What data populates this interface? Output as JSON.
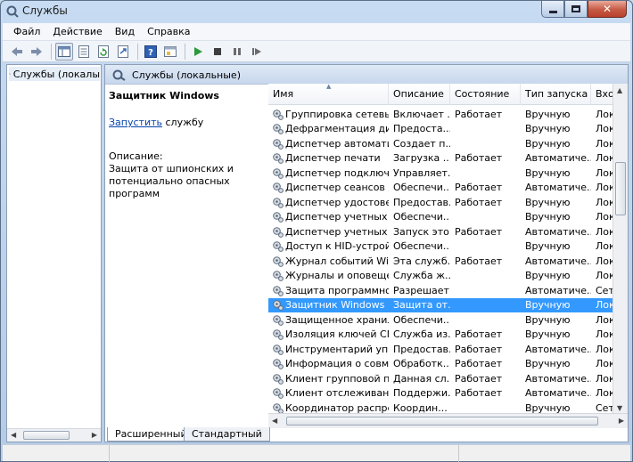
{
  "window": {
    "title": "Службы"
  },
  "menu": [
    "Файл",
    "Действие",
    "Вид",
    "Справка"
  ],
  "toolbar": [
    "back-icon",
    "forward-icon",
    "console-tree-icon",
    "properties-icon",
    "refresh-icon",
    "export-icon",
    "help-icon",
    "view-icon",
    "start-icon",
    "stop-icon",
    "pause-icon",
    "restart-icon"
  ],
  "tree": {
    "item": "Службы (локалы"
  },
  "panel": {
    "title": "Службы (локальные)"
  },
  "detail": {
    "name": "Защитник Windows",
    "action_link": "Запустить",
    "action_suffix": " службу",
    "desc_label": "Описание:",
    "desc_line1": "Защита от шпионских  и",
    "desc_line2": "потенциально опасных программ"
  },
  "table": {
    "headers": [
      "Имя",
      "Описание",
      "Состояние",
      "Тип запуска",
      "Вход"
    ],
    "selected_index": 13,
    "rows": [
      [
        "Группировка сетевых ...",
        "Включает ...",
        "Работает",
        "Вручную",
        "Лока"
      ],
      [
        "Дефрагментация диска",
        "Предоста...",
        "",
        "Вручную",
        "Лока"
      ],
      [
        "Диспетчер автоматич...",
        "Создает п...",
        "",
        "Вручную",
        "Лока"
      ],
      [
        "Диспетчер печати",
        "Загрузка ...",
        "Работает",
        "Автоматиче...",
        "Лока"
      ],
      [
        "Диспетчер подключе...",
        "Управляет...",
        "",
        "Вручную",
        "Лока"
      ],
      [
        "Диспетчер сеансов д...",
        "Обеспечи...",
        "Работает",
        "Автоматиче...",
        "Лока"
      ],
      [
        "Диспетчер удостовер...",
        "Предостав...",
        "Работает",
        "Вручную",
        "Лока"
      ],
      [
        "Диспетчер учетных д...",
        "Обеспечи...",
        "",
        "Вручную",
        "Лока"
      ],
      [
        "Диспетчер учетных за...",
        "Запуск это...",
        "Работает",
        "Автоматиче...",
        "Лока"
      ],
      [
        "Доступ к HID-устройс...",
        "Обеспечи...",
        "",
        "Вручную",
        "Лока"
      ],
      [
        "Журнал событий Win...",
        "Эта служб...",
        "Работает",
        "Автоматиче...",
        "Лока"
      ],
      [
        "Журналы и оповеще...",
        "Служба ж...",
        "",
        "Вручную",
        "Лока"
      ],
      [
        "Защита программног...",
        "Разрешает...",
        "",
        "Автоматиче...",
        "Сете"
      ],
      [
        "Защитник Windows",
        "Защита от...",
        "",
        "Вручную",
        "Лока"
      ],
      [
        "Защищенное хранил...",
        "Обеспечи...",
        "",
        "Вручную",
        "Лока"
      ],
      [
        "Изоляция ключей CNG",
        "Служба из...",
        "Работает",
        "Вручную",
        "Лока"
      ],
      [
        "Инструментарий упр...",
        "Предостав...",
        "Работает",
        "Автоматиче...",
        "Лока"
      ],
      [
        "Информация о совме...",
        "Обработк...",
        "Работает",
        "Вручную",
        "Лока"
      ],
      [
        "Клиент групповой по...",
        "Данная сл...",
        "Работает",
        "Автоматиче...",
        "Лока"
      ],
      [
        "Клиент отслеживания...",
        "Поддержи...",
        "Работает",
        "Автоматиче...",
        "Лока"
      ],
      [
        "Координатор распред...",
        "Координ...",
        "",
        "Вручную",
        "Сете"
      ]
    ]
  },
  "tabs": [
    "Расширенный",
    "Стандартный"
  ],
  "colors": {
    "selection": "#3399ff",
    "link": "#0645ad"
  }
}
